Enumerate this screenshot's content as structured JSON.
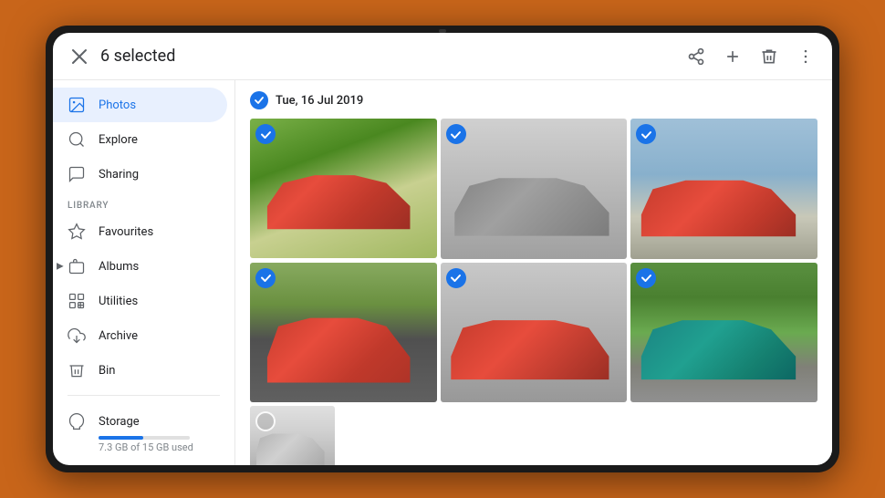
{
  "header": {
    "selected_count": "6 selected",
    "icons": {
      "close": "✕",
      "share": "share",
      "add": "+",
      "delete": "delete",
      "more": "⋮"
    }
  },
  "sidebar": {
    "nav_items": [
      {
        "id": "photos",
        "label": "Photos",
        "active": true
      },
      {
        "id": "explore",
        "label": "Explore",
        "active": false
      },
      {
        "id": "sharing",
        "label": "Sharing",
        "active": false
      }
    ],
    "library_label": "LIBRARY",
    "library_items": [
      {
        "id": "favourites",
        "label": "Favourites"
      },
      {
        "id": "albums",
        "label": "Albums"
      },
      {
        "id": "utilities",
        "label": "Utilities"
      },
      {
        "id": "archive",
        "label": "Archive"
      },
      {
        "id": "bin",
        "label": "Bin"
      }
    ],
    "storage": {
      "label": "Storage",
      "used_text": "7.3 GB of 15 GB used",
      "fill_percent": 49
    }
  },
  "main": {
    "date_label": "Tue, 16 Jul 2019",
    "photos": [
      {
        "id": 1,
        "selected": true,
        "class": "photo-1"
      },
      {
        "id": 2,
        "selected": true,
        "class": "photo-2"
      },
      {
        "id": 3,
        "selected": true,
        "class": "photo-3"
      },
      {
        "id": 4,
        "selected": true,
        "class": "photo-4"
      },
      {
        "id": 5,
        "selected": true,
        "class": "photo-5"
      },
      {
        "id": 6,
        "selected": true,
        "class": "photo-6"
      },
      {
        "id": 7,
        "selected": false,
        "class": "photo-7"
      }
    ]
  },
  "colors": {
    "accent": "#1a73e8",
    "sidebar_active_bg": "#e8f0fe",
    "text_primary": "#202124",
    "text_secondary": "#5f6368",
    "divider": "#e8e8e8"
  }
}
